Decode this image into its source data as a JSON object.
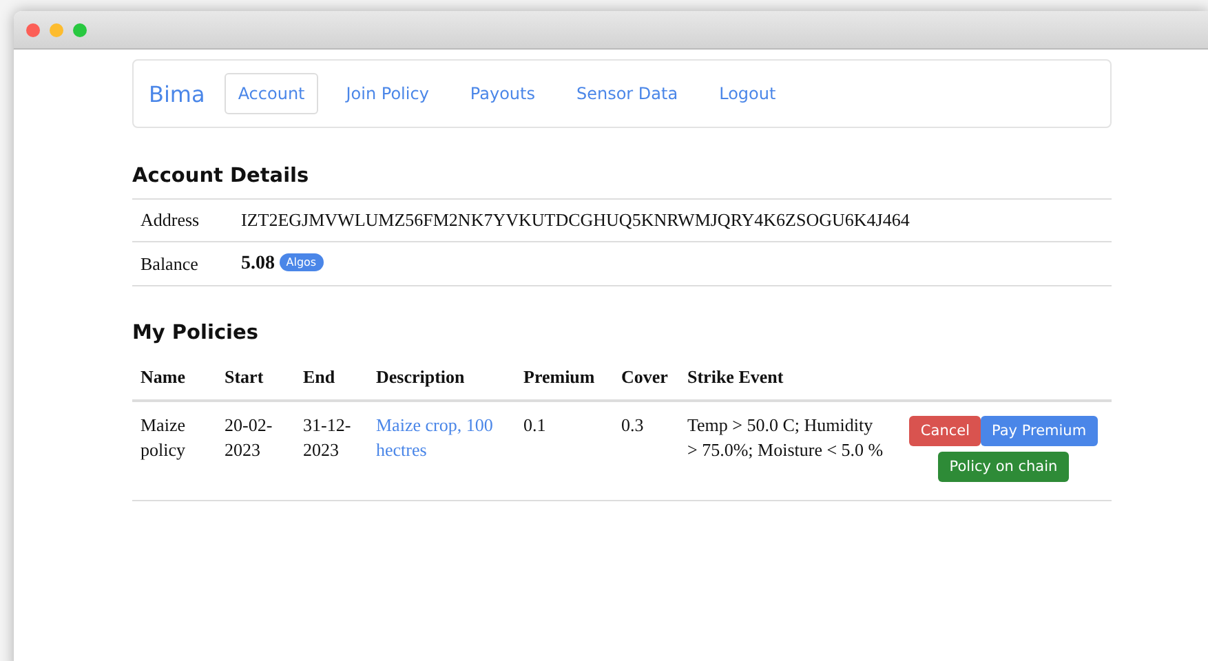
{
  "nav": {
    "brand": "Bima",
    "items": [
      {
        "label": "Account",
        "selected": true
      },
      {
        "label": "Join Policy",
        "selected": false
      },
      {
        "label": "Payouts",
        "selected": false
      },
      {
        "label": "Sensor Data",
        "selected": false
      },
      {
        "label": "Logout",
        "selected": false
      }
    ]
  },
  "account": {
    "title": "Account Details",
    "rows": [
      {
        "label": "Address",
        "value": "IZT2EGJMVWLUMZ56FM2NK7YVKUTDCGHUQ5KNRWMJQRY4K6ZSOGU6K4J464"
      },
      {
        "label": "Balance",
        "value": "5.08",
        "badge": "Algos"
      }
    ]
  },
  "policies": {
    "title": "My Policies",
    "columns": [
      "Name",
      "Start",
      "End",
      "Description",
      "Premium",
      "Cover",
      "Strike Event"
    ],
    "rows": [
      {
        "name": "Maize policy",
        "start": "20-02-2023",
        "end": "31-12-2023",
        "description": "Maize crop, 100 hectres",
        "premium": "0.1",
        "cover": "0.3",
        "strike_event": "Temp > 50.0 C; Humidity > 75.0%; Moisture < 5.0 %",
        "actions": [
          {
            "label": "Cancel",
            "kind": "danger"
          },
          {
            "label": "Pay Premium",
            "kind": "primary"
          },
          {
            "label": "Policy on chain",
            "kind": "success"
          }
        ]
      }
    ]
  }
}
